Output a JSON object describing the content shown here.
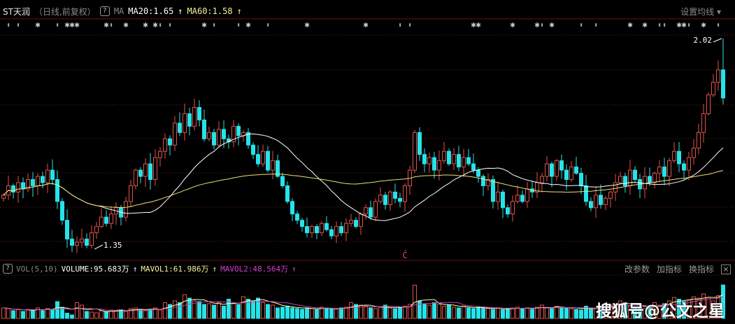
{
  "header": {
    "stock": "ST天润",
    "mode": "（日线,前复权）",
    "help": "?",
    "ma_label": "MA",
    "ma20": "MA20:1.65",
    "ma60": "MA60:1.58",
    "arrow": "↑",
    "settings": "设置均线 ▾"
  },
  "volume_header": {
    "help": "?",
    "name": "VOL(5,10)",
    "volume": "VOLUME:95.683万",
    "mavol1": "MAVOL1:61.986万",
    "mavol2": "MAVOL2:48.564万",
    "arrow": "↑",
    "buttons": [
      "改参数",
      "加指标",
      "换指标"
    ],
    "close": "×"
  },
  "watermark": "搜狐号@公文之星",
  "colors": {
    "up": "#e0524a",
    "down": "#25e3e8",
    "ma20": "#ffffff",
    "ma60": "#e8e27a",
    "mavol1": "#ffffa0",
    "mavol2": "#c040c0",
    "grid": "#7a1d1d"
  },
  "chart_data": {
    "type": "candlestick",
    "price_range": [
      1.3,
      2.05
    ],
    "high_label": "2.02",
    "low_label": "1.35",
    "high_value": 2.02,
    "low_value": 1.35,
    "high_index": 147,
    "low_index": 18,
    "closes": [
      1.52,
      1.55,
      1.53,
      1.56,
      1.54,
      1.57,
      1.55,
      1.58,
      1.56,
      1.6,
      1.57,
      1.5,
      1.44,
      1.38,
      1.36,
      1.37,
      1.38,
      1.36,
      1.4,
      1.42,
      1.45,
      1.43,
      1.46,
      1.48,
      1.45,
      1.5,
      1.55,
      1.6,
      1.58,
      1.62,
      1.57,
      1.64,
      1.66,
      1.7,
      1.68,
      1.75,
      1.72,
      1.78,
      1.74,
      1.8,
      1.76,
      1.7,
      1.72,
      1.68,
      1.73,
      1.7,
      1.69,
      1.74,
      1.71,
      1.72,
      1.68,
      1.65,
      1.62,
      1.66,
      1.6,
      1.63,
      1.58,
      1.55,
      1.5,
      1.46,
      1.44,
      1.42,
      1.4,
      1.42,
      1.4,
      1.43,
      1.41,
      1.39,
      1.42,
      1.4,
      1.43,
      1.44,
      1.42,
      1.46,
      1.48,
      1.45,
      1.5,
      1.52,
      1.49,
      1.53,
      1.51,
      1.5,
      1.55,
      1.6,
      1.72,
      1.65,
      1.62,
      1.64,
      1.6,
      1.63,
      1.66,
      1.62,
      1.65,
      1.61,
      1.64,
      1.62,
      1.6,
      1.58,
      1.55,
      1.57,
      1.5,
      1.53,
      1.48,
      1.46,
      1.5,
      1.52,
      1.5,
      1.54,
      1.53,
      1.56,
      1.58,
      1.62,
      1.58,
      1.63,
      1.6,
      1.57,
      1.61,
      1.59,
      1.55,
      1.5,
      1.48,
      1.52,
      1.49,
      1.51,
      1.53,
      1.56,
      1.58,
      1.55,
      1.6,
      1.57,
      1.54,
      1.58,
      1.56,
      1.59,
      1.61,
      1.58,
      1.63,
      1.66,
      1.62,
      1.6,
      1.64,
      1.67,
      1.72,
      1.78,
      1.84,
      1.88,
      1.92,
      1.83
    ],
    "volumes": [
      30,
      28,
      22,
      25,
      20,
      26,
      24,
      30,
      22,
      28,
      25,
      48,
      32,
      15,
      10,
      45,
      38,
      20,
      18,
      16,
      22,
      20,
      24,
      22,
      25,
      20,
      28,
      30,
      26,
      22,
      25,
      30,
      24,
      45,
      40,
      50,
      45,
      68,
      58,
      50,
      48,
      40,
      42,
      38,
      45,
      35,
      55,
      42,
      40,
      62,
      55,
      50,
      58,
      45,
      40,
      38,
      30,
      32,
      35,
      30,
      28,
      26,
      30,
      28,
      25,
      32,
      30,
      28,
      26,
      30,
      32,
      45,
      40,
      38,
      35,
      30,
      28,
      32,
      38,
      30,
      28,
      32,
      35,
      40,
      95,
      50,
      42,
      38,
      45,
      40,
      35,
      38,
      32,
      30,
      35,
      30,
      28,
      32,
      30,
      28,
      26,
      30,
      25,
      28,
      30,
      32,
      28,
      30,
      26,
      32,
      38,
      30,
      28,
      35,
      32,
      30,
      28,
      26,
      24,
      35,
      30,
      28,
      32,
      40,
      38,
      42,
      50,
      45,
      35,
      30,
      32,
      28,
      30,
      45,
      38,
      42,
      50,
      60,
      55,
      48,
      52,
      62,
      58,
      70,
      60,
      50,
      65,
      95.683
    ],
    "markers": [
      {
        "i": 1,
        "t": "d"
      },
      {
        "i": 3,
        "t": "d"
      },
      {
        "i": 7,
        "t": "s"
      },
      {
        "i": 11,
        "t": "d"
      },
      {
        "i": 13,
        "t": "s"
      },
      {
        "i": 14,
        "t": "s"
      },
      {
        "i": 15,
        "t": "s"
      },
      {
        "i": 21,
        "t": "s"
      },
      {
        "i": 22,
        "t": "d"
      },
      {
        "i": 25,
        "t": "s"
      },
      {
        "i": 29,
        "t": "s"
      },
      {
        "i": 31,
        "t": "s"
      },
      {
        "i": 32,
        "t": "d"
      },
      {
        "i": 34,
        "t": "d"
      },
      {
        "i": 41,
        "t": "s"
      },
      {
        "i": 43,
        "t": "d"
      },
      {
        "i": 48,
        "t": "d"
      },
      {
        "i": 50,
        "t": "s"
      },
      {
        "i": 54,
        "t": "d"
      },
      {
        "i": 62,
        "t": "s"
      },
      {
        "i": 74,
        "t": "s"
      },
      {
        "i": 81,
        "t": "d"
      },
      {
        "i": 83,
        "t": "d"
      },
      {
        "i": 96,
        "t": "s"
      },
      {
        "i": 97,
        "t": "s"
      },
      {
        "i": 104,
        "t": "s"
      },
      {
        "i": 109,
        "t": "s"
      },
      {
        "i": 110,
        "t": "d"
      },
      {
        "i": 112,
        "t": "s"
      },
      {
        "i": 118,
        "t": "d"
      },
      {
        "i": 121,
        "t": "d"
      },
      {
        "i": 128,
        "t": "s"
      },
      {
        "i": 131,
        "t": "s"
      },
      {
        "i": 134,
        "t": "d"
      },
      {
        "i": 135,
        "t": "d"
      },
      {
        "i": 138,
        "t": "s"
      },
      {
        "i": 139,
        "t": "s"
      },
      {
        "i": 140,
        "t": "d"
      },
      {
        "i": 143,
        "t": "s"
      },
      {
        "i": 146,
        "t": "d"
      }
    ],
    "signal": {
      "i": 82,
      "label": "Ĉ"
    }
  }
}
